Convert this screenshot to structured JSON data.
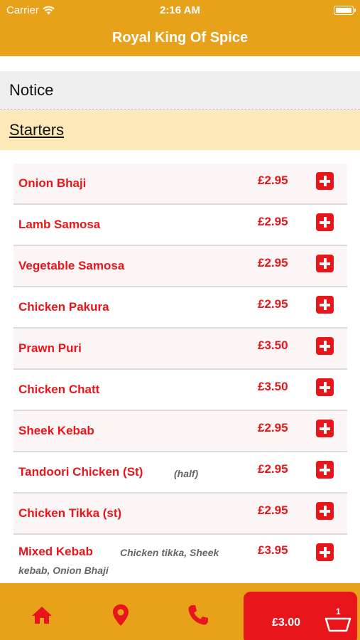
{
  "status_bar": {
    "carrier": "Carrier",
    "time": "2:16 AM"
  },
  "header": {
    "title": "Royal King Of Spice"
  },
  "notice": {
    "label": "Notice"
  },
  "category": {
    "label": "Starters"
  },
  "items": [
    {
      "name": "Onion Bhaji",
      "price": "£2.95"
    },
    {
      "name": "Lamb Samosa",
      "price": "£2.95"
    },
    {
      "name": "Vegetable Samosa",
      "price": "£2.95"
    },
    {
      "name": "Chicken Pakura",
      "price": "£2.95"
    },
    {
      "name": "Prawn Puri",
      "price": "£3.50"
    },
    {
      "name": "Chicken Chatt",
      "price": "£3.50"
    },
    {
      "name": "Sheek Kebab",
      "price": "£2.95"
    },
    {
      "name": "Tandoori Chicken (St)",
      "note": "(half)",
      "price": "£2.95"
    },
    {
      "name": "Chicken Tikka (st)",
      "price": "£2.95"
    },
    {
      "name": "Mixed Kebab",
      "note_line1": "Chicken tikka, Sheek",
      "note_line2": "kebab, Onion Bhaji",
      "price": "£3.95"
    }
  ],
  "bottom_bar": {
    "icons": [
      "home-icon",
      "location-pin-icon",
      "phone-icon"
    ],
    "cart_total": "£3.00",
    "cart_count": "1"
  },
  "colors": {
    "brand": "#E8A219",
    "accent_red": "#E8161B",
    "category_bg": "#FDE8B8",
    "notice_bg": "#EFEFEF"
  }
}
